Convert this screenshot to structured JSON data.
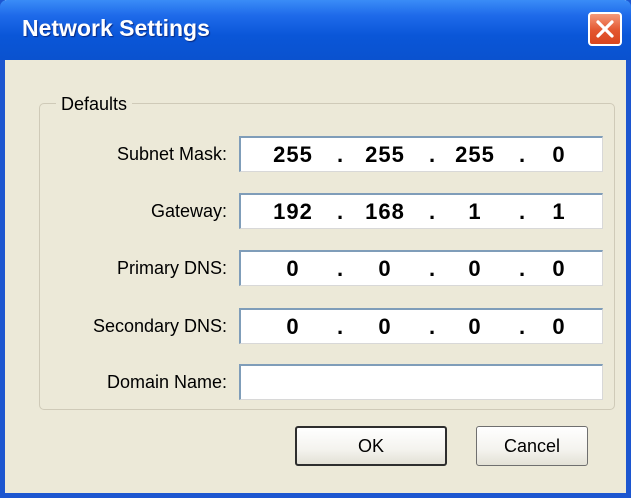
{
  "window": {
    "title": "Network Settings"
  },
  "group": {
    "label": "Defaults"
  },
  "fields": {
    "subnet_mask": {
      "label": "Subnet Mask:",
      "octets": [
        "255",
        "255",
        "255",
        "0"
      ]
    },
    "gateway": {
      "label": "Gateway:",
      "octets": [
        "192",
        "168",
        "1",
        "1"
      ]
    },
    "primary_dns": {
      "label": "Primary DNS:",
      "octets": [
        "0",
        "0",
        "0",
        "0"
      ]
    },
    "secondary_dns": {
      "label": "Secondary DNS:",
      "octets": [
        "0",
        "0",
        "0",
        "0"
      ]
    },
    "domain_name": {
      "label": "Domain Name:",
      "value": ""
    }
  },
  "separator": ".",
  "buttons": {
    "ok_label": "OK",
    "cancel_label": "Cancel"
  },
  "icons": {
    "close": "close-icon"
  },
  "colors": {
    "titlebar": "#0a56d8",
    "close_button": "#e3562f",
    "dialog_background": "#ece9d8",
    "field_border": "#7f9db9"
  }
}
